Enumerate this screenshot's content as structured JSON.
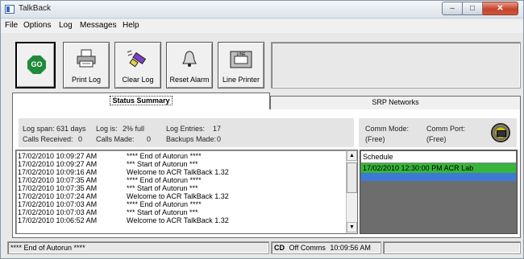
{
  "window": {
    "title": "TalkBack",
    "minimize": "–",
    "maximize": "□",
    "close": "✕"
  },
  "menu": [
    "File",
    "Options",
    "Log",
    "Messages",
    "Help"
  ],
  "toolbar": {
    "go_label": "GO",
    "buttons": [
      {
        "label": "Print Log",
        "icon": "printer-icon"
      },
      {
        "label": "Clear Log",
        "icon": "clear-log-icon"
      },
      {
        "label": "Reset Alarm",
        "icon": "bell-icon"
      },
      {
        "label": "Line Printer",
        "icon": "line-printer-icon",
        "icon_text": "LINE"
      }
    ]
  },
  "tabs": {
    "active": "Status Summary",
    "inactive": "SRP Networks"
  },
  "stats": {
    "log_span_label": "Log span:",
    "log_span_value": "631 days",
    "log_is_label": "Log is:",
    "log_is_value": "2% full",
    "log_entries_label": "Log Entries:",
    "log_entries_value": "17",
    "calls_received_label": "Calls Received:",
    "calls_received_value": "0",
    "calls_made_label": "Calls Made:",
    "calls_made_value": "0",
    "backups_label": "Backups Made:",
    "backups_value": "0"
  },
  "comm": {
    "mode_label": "Comm Mode:",
    "mode_value": "(Free)",
    "port_label": "Comm Port:",
    "port_value": "(Free)"
  },
  "log_entries": [
    {
      "time": "17/02/2010 10:09:27 AM",
      "message": "**** End of Autorun ****"
    },
    {
      "time": "17/02/2010 10:09:27 AM",
      "message": "*** Start of Autorun ***"
    },
    {
      "time": "17/02/2010 10:09:16 AM",
      "message": "Welcome to ACR TalkBack 1.32"
    },
    {
      "time": "17/02/2010 10:07:35 AM",
      "message": "**** End of Autorun ****"
    },
    {
      "time": "17/02/2010 10:07:35 AM",
      "message": "*** Start of Autorun ***"
    },
    {
      "time": "17/02/2010 10:07:24 AM",
      "message": "Welcome to ACR TalkBack 1.32"
    },
    {
      "time": "17/02/2010 10:07:03 AM",
      "message": "**** End of Autorun ****"
    },
    {
      "time": "17/02/2010 10:07:03 AM",
      "message": "*** Start of Autorun ***"
    },
    {
      "time": "17/02/2010 10:06:52 AM",
      "message": "Welcome to ACR TalkBack 1.32"
    }
  ],
  "schedule": {
    "header": "Schedule",
    "rows": [
      "17/02/2010 12:30:00 PM  ACR Lab"
    ]
  },
  "statusbar": {
    "message": "**** End of Autorun ****",
    "cd": "CD",
    "comms": "Off Comms",
    "time": "10:09:56 AM"
  },
  "colors": {
    "schedule_row": "#37b53a",
    "schedule_selection": "#3c7ad6",
    "go_button": "#1f8a3a",
    "close_button": "#c4452e"
  }
}
